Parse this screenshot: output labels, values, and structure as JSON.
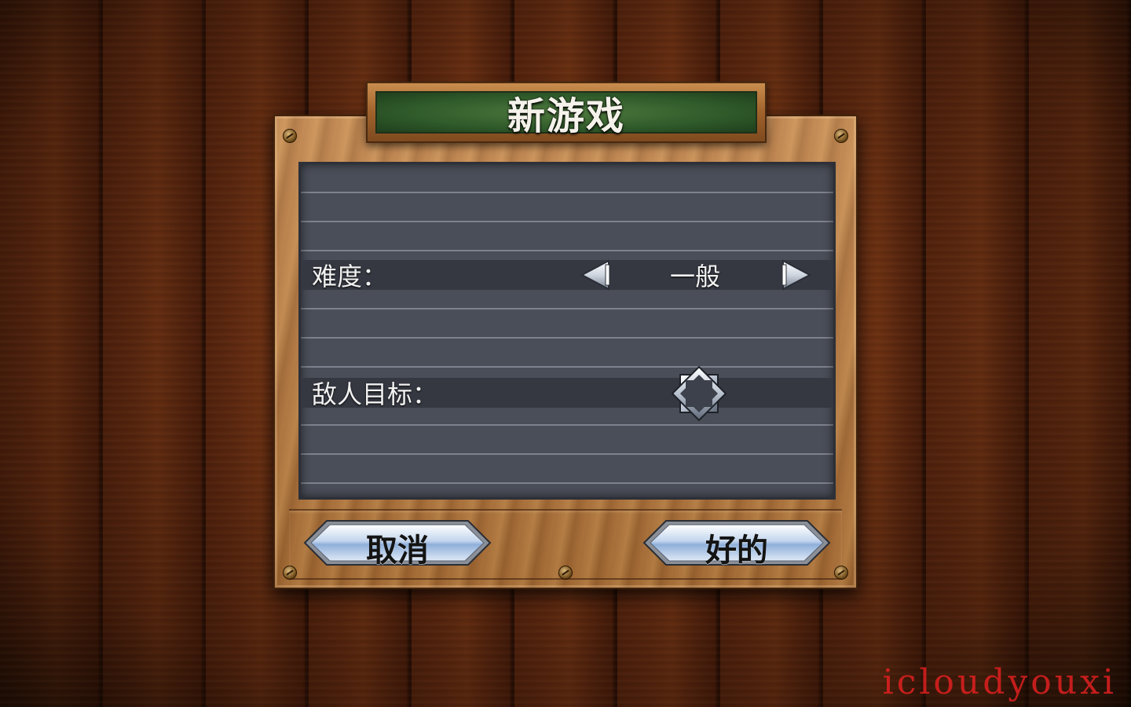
{
  "screen": {
    "title": "新游戏"
  },
  "settings": {
    "difficulty": {
      "label": "难度：",
      "value": "一般",
      "prev_icon": "arrow-left-icon",
      "next_icon": "arrow-right-icon"
    },
    "enemy_goal": {
      "label": "敌人目标：",
      "checked": false,
      "icon": "octagram-checkbox-icon"
    }
  },
  "buttons": {
    "cancel_label": "取消",
    "ok_label": "好的"
  },
  "watermark": "icloudyouxi",
  "colors": {
    "title_green": "#2f5a2a",
    "board_gray": "#4a4e58",
    "row_dark": "#353841",
    "button_blue": "#a9c3e6",
    "watermark_red": "#e02020"
  }
}
